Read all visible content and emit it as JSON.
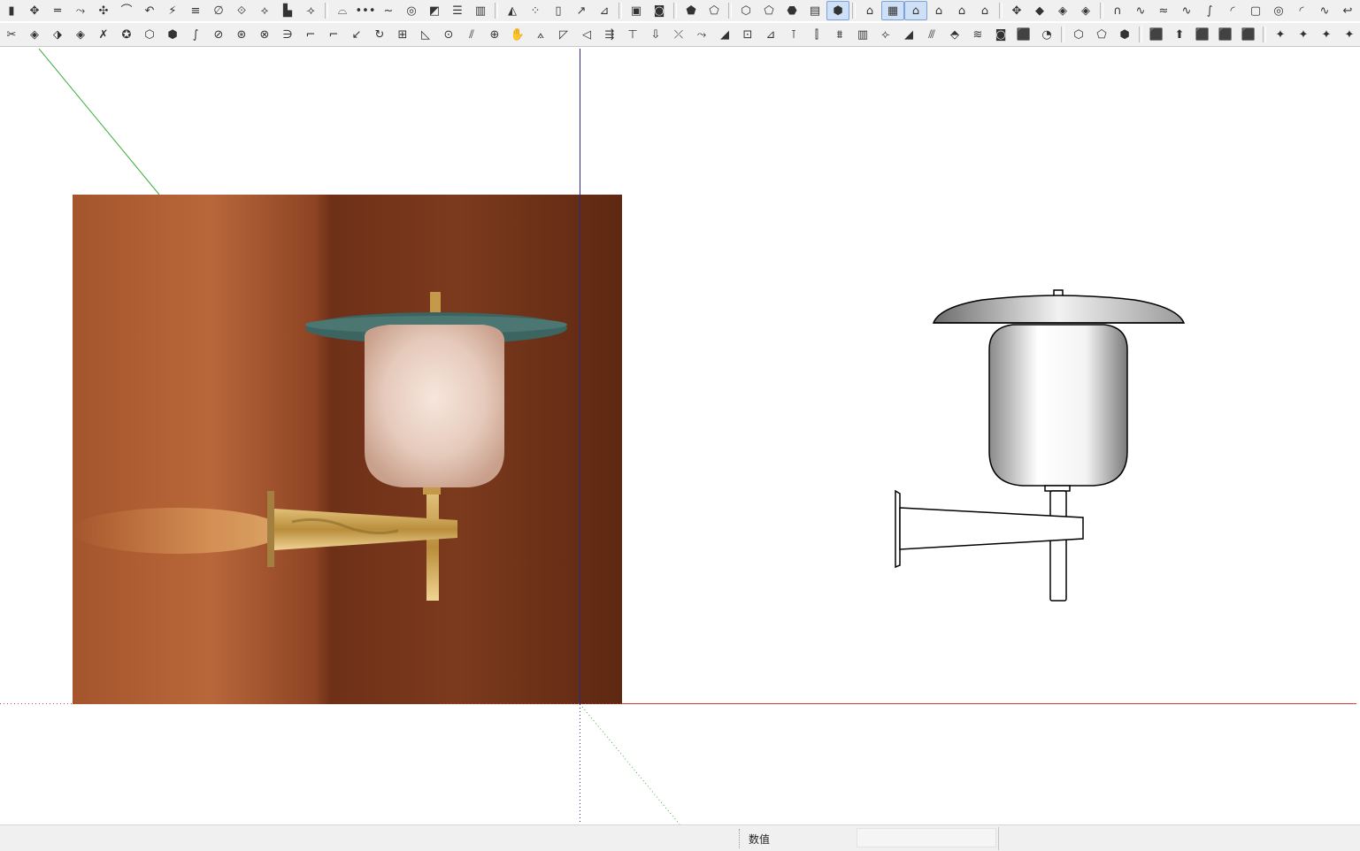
{
  "window": {
    "app": "SketchUp"
  },
  "toolbar_row1": {
    "groups": [
      [
        "▮",
        "✥",
        "═",
        "⤳",
        "✣",
        "⌒",
        "↶",
        "⚡",
        "≡",
        "∅",
        "⟐",
        "⟡",
        "▙",
        "⟢"
      ],
      [
        "⌓",
        "•••",
        "∼",
        "◎",
        "◩",
        "☰",
        "▥"
      ],
      [
        "◭",
        "⁘",
        "▯",
        "↗",
        "⊿"
      ],
      [
        "▣",
        "◙"
      ],
      [
        "⬟",
        "⬠"
      ],
      [
        "⬡",
        "⬠",
        "⬣",
        "▤",
        "⬢"
      ],
      [
        "⌂",
        "▦",
        "⌂",
        "⌂",
        "⌂",
        "⌂"
      ],
      [
        "✥",
        "◆",
        "◈",
        "◈"
      ],
      [
        "∩",
        "∿",
        "≈",
        "∿",
        "∫",
        "◜",
        "▢",
        "◎",
        "◜",
        "∿",
        "↩"
      ]
    ],
    "active_index": [
      34,
      36,
      37
    ]
  },
  "toolbar_row2": {
    "groups": [
      [
        "✂",
        "◈",
        "⬗",
        "◈",
        "✗",
        "✪",
        "⬡",
        "⬢",
        "∫",
        "⊘",
        "⊛",
        "⊗",
        "∋",
        "⌐",
        "⌐",
        "↙",
        "↻",
        "⊞",
        "◺",
        "⊙",
        "⫽",
        "⊕",
        "✋",
        "⟑",
        "◸",
        "◁",
        "⇶",
        "⊤",
        "⇩",
        "⤫",
        "⤳",
        "◢",
        "⊡",
        "⊿",
        "⊺",
        "⫿",
        "⩩",
        "▥",
        "⟣",
        "◢",
        "⫻",
        "⬘",
        "≋",
        "◙",
        "⬛",
        "◔"
      ],
      [
        "⬡",
        "⬠",
        "⬢"
      ],
      [
        "⬛",
        "⬆",
        "⬛",
        "⬛",
        "⬛"
      ],
      [
        "✦",
        "✦",
        "✦",
        "✦"
      ]
    ]
  },
  "viewport": {
    "reference_photo": {
      "name": "wall-sconce-photo"
    },
    "model": {
      "name": "wall-sconce-model"
    },
    "axes": {
      "green_color": "#3fae3f",
      "blue_color": "#2a2a8a",
      "red_color": "#d03a3a"
    },
    "colors": {
      "wood_light": "#b5653a",
      "wood_dark": "#6b2e16",
      "shade": "#3c6460",
      "glass": "#e8d2c6",
      "brass": "#c49a4a"
    }
  },
  "statusbar": {
    "label": "数值",
    "value": ""
  }
}
